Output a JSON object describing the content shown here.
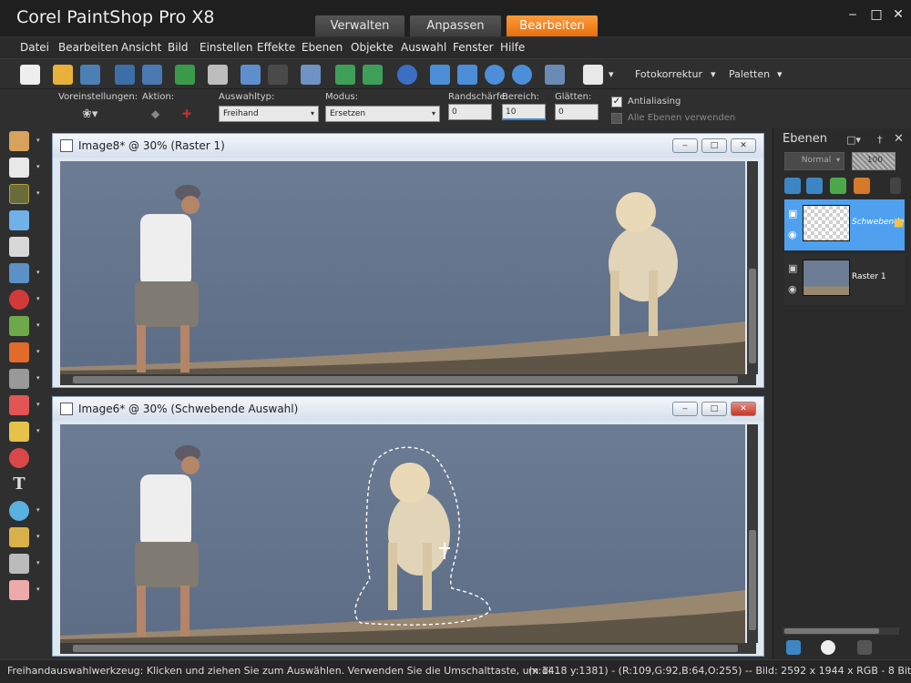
{
  "app": {
    "title": "Corel PaintShop Pro X8"
  },
  "workspace_tabs": [
    {
      "label": "Verwalten",
      "active": false
    },
    {
      "label": "Anpassen",
      "active": false
    },
    {
      "label": "Bearbeiten",
      "active": true
    }
  ],
  "menu": [
    "Datei",
    "Bearbeiten",
    "Ansicht",
    "Bild",
    "Einstellen",
    "Effekte",
    "Ebenen",
    "Objekte",
    "Auswahl",
    "Fenster",
    "Hilfe"
  ],
  "toolbar": {
    "photo_fix_label": "Fotokorrektur",
    "palettes_label": "Paletten"
  },
  "tool_options": {
    "presets_label": "Voreinstellungen:",
    "action_label": "Aktion:",
    "selection_type_label": "Auswahltyp:",
    "selection_type_value": "Freihand",
    "mode_label": "Modus:",
    "mode_value": "Ersetzen",
    "feather_label": "Randschärfe:",
    "feather_value": "0",
    "range_label": "Bereich:",
    "range_value": "10",
    "smoothing_label": "Glätten:",
    "smoothing_value": "0",
    "antialias_label": "Antialiasing",
    "antialias_checked": true,
    "all_layers_label": "Alle Ebenen verwenden",
    "all_layers_checked": false
  },
  "documents": [
    {
      "title": "Image8* @  30% (Raster 1)"
    },
    {
      "title": "Image6* @  30% (Schwebende Auswahl)"
    }
  ],
  "layers_palette": {
    "title": "Ebenen",
    "blend_mode": "Normal",
    "opacity": "100",
    "layers": [
      {
        "name": "Schwebende",
        "active": true
      },
      {
        "name": "Raster 1",
        "active": false
      }
    ]
  },
  "status": {
    "hint": "Freihandauswahlwerkzeug: Klicken und ziehen Sie zum Auswählen. Verwenden Sie die Umschalttaste, um di...",
    "info": "(x:1418 y:1381) - (R:109,G:92,B:64,O:255) -- Bild:  2592 x 1944 x RGB - 8 Bit/Kanal"
  },
  "colors": {
    "accent": "#f07e1e",
    "layer_active": "#4fa1f0",
    "window_frame": "#dfe7f0"
  }
}
